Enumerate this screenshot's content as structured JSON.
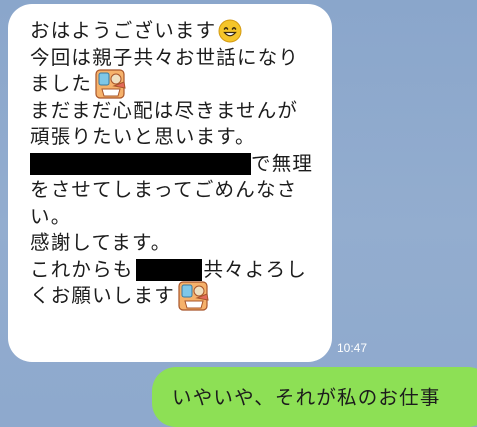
{
  "incoming_message": {
    "lines": [
      "おはようございます",
      "今回は親子共々お世話になり",
      "ました",
      "まだまだ心配は尽きませんが",
      "頑張りたいと思います。",
      "で無理",
      "をさせてしまってごめんなさ",
      "い。",
      "感謝してます。",
      "これからも",
      "共々よろし",
      "くお願いします"
    ],
    "emoji_icons": [
      "smiling-face-emoji",
      "greeting-sticker-emoji"
    ],
    "timestamp": "10:47"
  },
  "outgoing_message": {
    "text": "いやいや、それが私のお仕事"
  },
  "colors": {
    "background": "#8ea9cd",
    "incoming_bubble": "#ffffff",
    "outgoing_bubble": "#8de055",
    "redaction": "#000000"
  }
}
